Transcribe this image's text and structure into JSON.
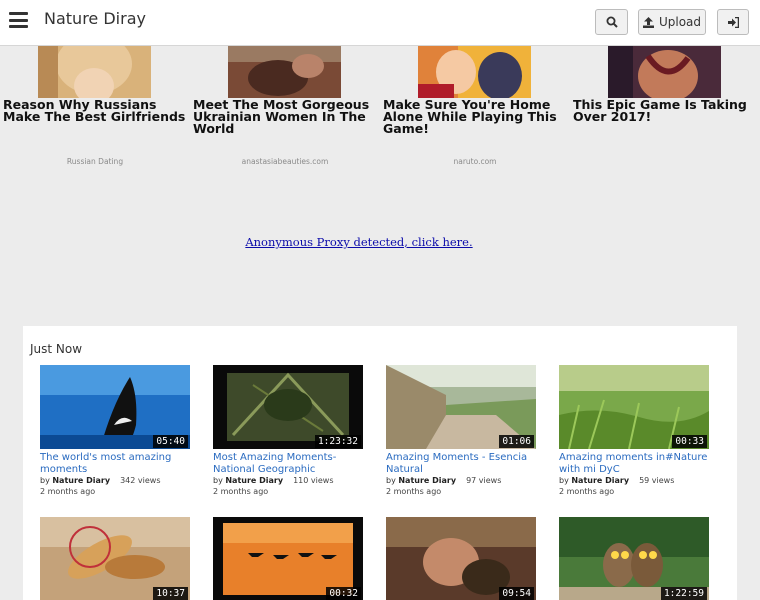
{
  "header": {
    "brand": "Nature Diray",
    "upload_label": "Upload"
  },
  "ads": [
    {
      "title": "Reason Why Russians Make The Best Girlfriends",
      "source": "Russian Dating"
    },
    {
      "title": "Meet The Most Gorgeous Ukrainian Women In The World",
      "source": "anastasiabeauties.com"
    },
    {
      "title": "Make Sure You're Home Alone While Playing This Game!",
      "source": "naruto.com"
    },
    {
      "title": "This Epic Game Is Taking Over 2017!",
      "source": ""
    }
  ],
  "proxy_notice": "Anonymous Proxy detected, click here.",
  "section_title": "Just Now",
  "videos": [
    {
      "title": "The world's most amazing moments",
      "duration": "05:40",
      "author": "Nature Diary",
      "views": "342 views",
      "time": "2 months ago"
    },
    {
      "title": "Most Amazing Moments- National Geographic",
      "duration": "1:23:32",
      "author": "Nature Diary",
      "views": "110 views",
      "time": "2 months ago"
    },
    {
      "title": "Amazing Moments - Esencia Natural",
      "duration": "01:06",
      "author": "Nature Diary",
      "views": "97 views",
      "time": "2 months ago"
    },
    {
      "title": "Amazing moments in#Nature with mi DyC",
      "duration": "00:33",
      "author": "Nature Diary",
      "views": "59 views",
      "time": "2 months ago"
    },
    {
      "duration": "10:37"
    },
    {
      "duration": "00:32"
    },
    {
      "duration": "09:54"
    },
    {
      "duration": "1:22:59"
    }
  ],
  "by_label": "by",
  "colors": {
    "link": "#2a6bc0",
    "proxy_link": "#0b0baa"
  }
}
